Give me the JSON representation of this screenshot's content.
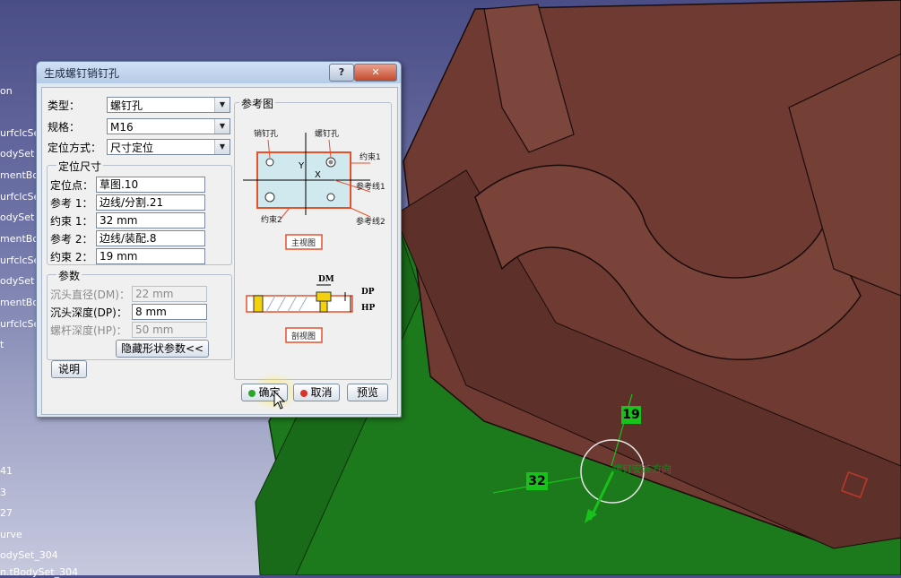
{
  "tree": {
    "items": [
      "on",
      "urfclcSe",
      "odySet",
      "mentBoc",
      "urfclcSe",
      "odySet",
      "mentBoc",
      "urfclcSe",
      "odySet",
      "mentBoc",
      "urfclcSe",
      "t",
      "41",
      "3",
      "27",
      "urve",
      "odySet_304",
      "n.tBodySet_304"
    ]
  },
  "dialog": {
    "title": "生成螺钉销钉孔",
    "help_label": "?",
    "close_label": "✕",
    "type_label": "类型：",
    "type_value": "螺钉孔",
    "spec_label": "规格：",
    "spec_value": "M16",
    "positioning_label": "定位方式：",
    "positioning_value": "尺寸定位",
    "position_size_group": "定位尺寸",
    "anchor_label": "定位点：",
    "anchor_value": "草图.10",
    "ref1_label": "参考 1：",
    "ref1_value": "边线/分割.21",
    "constraint1_label": "约束 1：",
    "constraint1_value": "32 mm",
    "ref2_label": "参考 2：",
    "ref2_value": "边线/装配.8",
    "constraint2_label": "约束 2：",
    "constraint2_value": "19 mm",
    "params_group": "参数",
    "dm_label": "沉头直径(DM)：",
    "dm_value": "22 mm",
    "dp_label": "沉头深度(DP)：",
    "dp_value": "8 mm",
    "hp_label": "螺杆深度(HP)：",
    "hp_value": "50 mm",
    "hide_params_button": "隐藏形状参数<<",
    "explain_button": "说明",
    "reference_group": "参考图",
    "ok_button": "确定",
    "cancel_button": "取消",
    "preview_button": "预览",
    "diagram": {
      "pin_hole": "销钉孔",
      "screw_hole": "螺钉孔",
      "constraint1": "约束1",
      "ref_line1": "参考线1",
      "constraint2": "约束2",
      "ref_line2": "参考线2",
      "y": "Y",
      "x": "X",
      "main_view": "主视图",
      "dm": "DM",
      "dp": "DP",
      "hp": "HP",
      "section_view": "剖视图"
    }
  },
  "viewport": {
    "dim_19": "19",
    "dim_32": "32",
    "direction_label": "螺钉安装方向"
  },
  "colors": {
    "model_brown": "#6e3a32",
    "model_green": "#1c7a1c",
    "dim_green": "#19c21a",
    "diagram_red": "#e8502a"
  }
}
